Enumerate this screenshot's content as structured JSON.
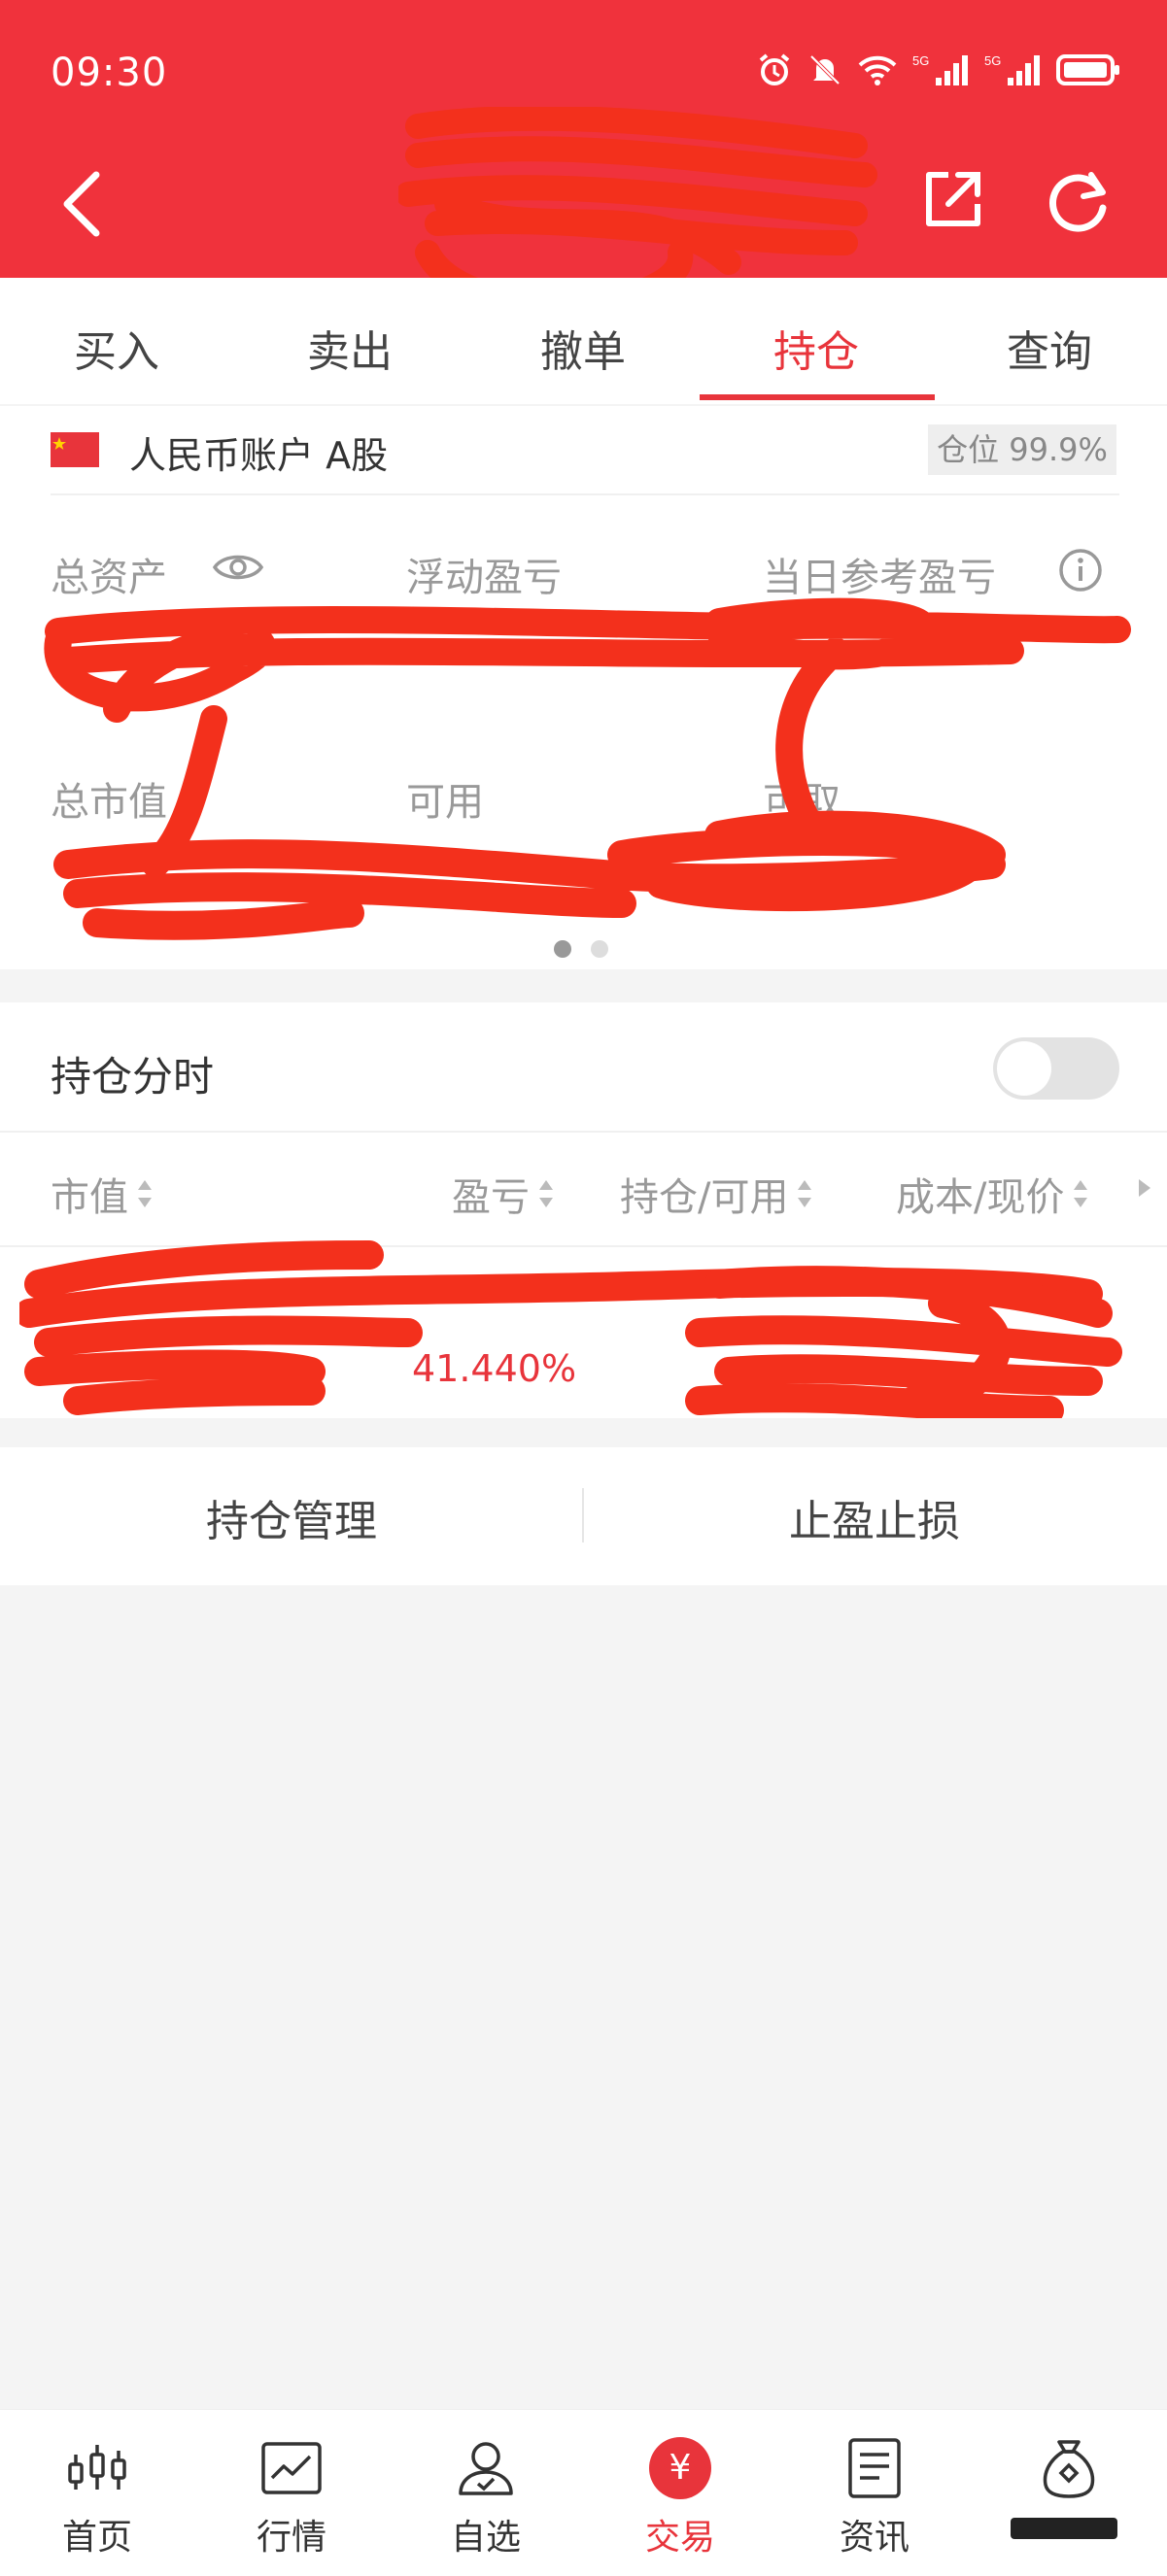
{
  "status": {
    "time": "09:30"
  },
  "tabs": [
    {
      "label": "买入"
    },
    {
      "label": "卖出"
    },
    {
      "label": "撤单"
    },
    {
      "label": "持仓"
    },
    {
      "label": "查询"
    }
  ],
  "account": {
    "name": "人民币账户 A股",
    "position_badge": "仓位 99.9%"
  },
  "stats": {
    "total_assets_label": "总资产",
    "floating_pl_label": "浮动盈亏",
    "daily_pl_label": "当日参考盈亏",
    "market_value_label": "总市值",
    "available_label": "可用",
    "withdrawable_label": "可取"
  },
  "holdings": {
    "title": "持仓分时",
    "columns": [
      "市值",
      "盈亏",
      "持仓/可用",
      "成本/现价"
    ],
    "rows": [
      {
        "profit_rate": "41.440%"
      }
    ]
  },
  "actions": {
    "manage": "持仓管理",
    "take_profit_stop_loss": "止盈止损"
  },
  "nav": [
    {
      "label": "首页",
      "icon": "candlestick-icon"
    },
    {
      "label": "行情",
      "icon": "chart-line-icon"
    },
    {
      "label": "自选",
      "icon": "user-check-icon"
    },
    {
      "label": "交易",
      "icon": "yen-icon"
    },
    {
      "label": "资讯",
      "icon": "document-icon"
    },
    {
      "label": "",
      "icon": "money-bag-icon"
    }
  ],
  "colors": {
    "brand": "#f0323c",
    "accent": "#e8343b",
    "redaction": "#f3301c"
  }
}
